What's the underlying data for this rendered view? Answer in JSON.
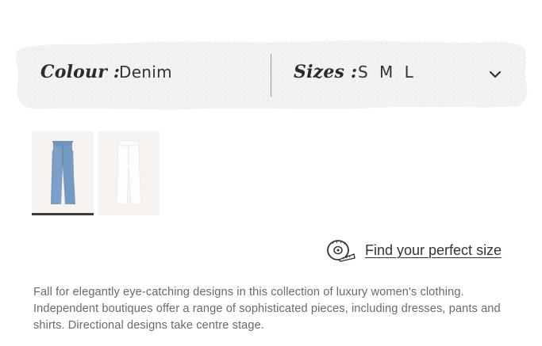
{
  "options": {
    "colour_label": "Colour :",
    "colour_value": "Denim",
    "sizes_label": "Sizes :",
    "sizes_value": "S M L"
  },
  "icons": {
    "dropdown": "chevron-down-icon",
    "size_guide": "measuring-tape-icon"
  },
  "thumbnails": [
    {
      "name": "denim-jeans",
      "color": "#7296bf",
      "selected": true
    },
    {
      "name": "white-jeans",
      "color": "#f2f2f0",
      "selected": false
    }
  ],
  "size_guide": {
    "link_text": "Find your perfect size"
  },
  "description": "Fall for elegantly eye-catching designs in this collection of luxury women's clothing. Independent boutiques offer a range of sophisticated pieces, including dresses, pants and shirts. Directional designs take centre stage.",
  "colors": {
    "text": "#2e2e2e",
    "muted_text": "#6a6a6a",
    "bar_background": "#f0f0ee",
    "selected_underline": "#3b3b3b"
  }
}
